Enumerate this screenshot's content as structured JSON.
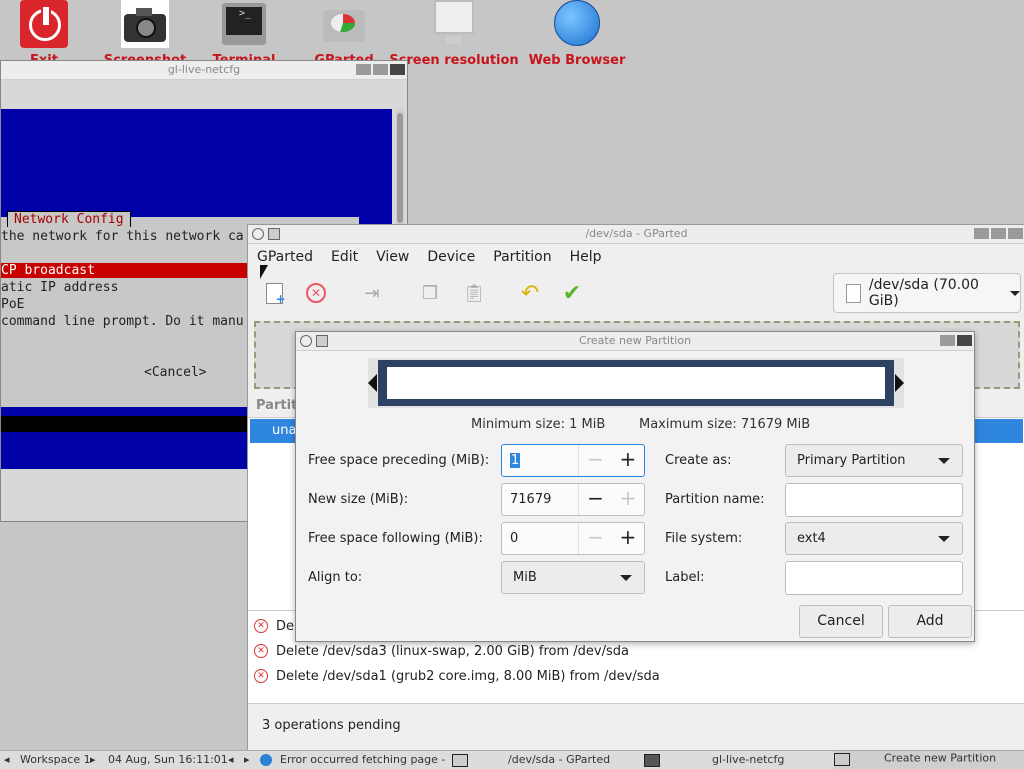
{
  "desktop": {
    "icons": [
      {
        "label": "Exit"
      },
      {
        "label": "Screenshot"
      },
      {
        "label": "Terminal"
      },
      {
        "label": "GParted"
      },
      {
        "label": "Screen resolution"
      },
      {
        "label": "Web Browser"
      }
    ]
  },
  "terminal_window": {
    "title": "gl-live-netcfg",
    "dialog_title": "Network Config",
    "lines": [
      "the network for this network ca",
      "CP broadcast",
      "atic IP address",
      "PoE",
      "command line prompt. Do it manu"
    ],
    "cancel": "<Cancel>"
  },
  "gparted": {
    "title": "/dev/sda - GParted",
    "menu": [
      "GParted",
      "Edit",
      "View",
      "Device",
      "Partition",
      "Help"
    ],
    "device": "/dev/sda (70.00 GiB)",
    "partition_header": "Partiti",
    "selected_row": "una",
    "operations": [
      "Dele",
      "Delete /dev/sda3 (linux-swap, 2.00 GiB) from /dev/sda",
      "Delete /dev/sda1 (grub2 core.img, 8.00 MiB) from /dev/sda"
    ],
    "status": "3 operations pending"
  },
  "dialog": {
    "title": "Create new Partition",
    "min_size": "Minimum size: 1 MiB",
    "max_size": "Maximum size: 71679 MiB",
    "free_preceding_label": "Free space preceding (MiB):",
    "free_preceding_value": "1",
    "new_size_label": "New size (MiB):",
    "new_size_value": "71679",
    "free_following_label": "Free space following (MiB):",
    "free_following_value": "0",
    "align_label": "Align to:",
    "align_value": "MiB",
    "create_as_label": "Create as:",
    "create_as_value": "Primary Partition",
    "partition_name_label": "Partition name:",
    "file_system_label": "File system:",
    "file_system_value": "ext4",
    "label_label": "Label:",
    "cancel": "Cancel",
    "add": "Add"
  },
  "taskbar": {
    "workspace": "Workspace 1",
    "datetime": "04 Aug, Sun 16:11:01",
    "browser_task": "Error occurred fetching page -",
    "gparted_task": "/dev/sda - GParted",
    "terminal_task": "gl-live-netcfg",
    "dialog_task": "Create new Partition"
  },
  "colors": {
    "desktop_label": "#c8141b",
    "terminal_blue": "#0000a8",
    "selection": "#2e86de",
    "partition_frame": "#2d4263"
  }
}
